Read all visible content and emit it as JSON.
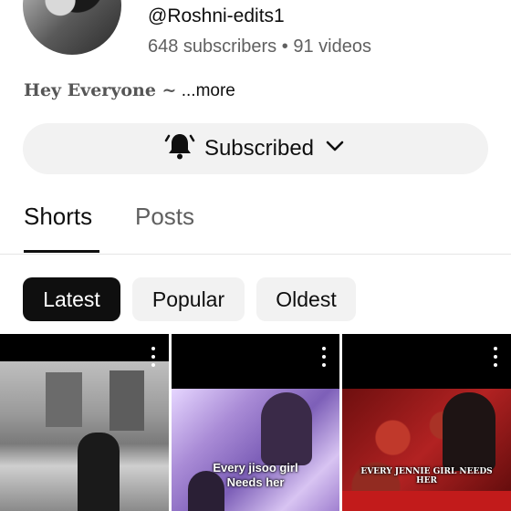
{
  "channel": {
    "handle": "@Roshni-edits1",
    "subscribers": "648 subscribers",
    "separator": "•",
    "videos": "91 videos",
    "description": "Hey Everyone ~",
    "more_label": "...more"
  },
  "subscribe_button": {
    "label": "Subscribed",
    "bell_icon": "bell-icon",
    "dropdown_icon": "chevron-down-icon"
  },
  "tabs": [
    {
      "label": "Shorts",
      "active": true
    },
    {
      "label": "Posts",
      "active": false
    }
  ],
  "filters": [
    {
      "label": "Latest",
      "selected": true
    },
    {
      "label": "Popular",
      "selected": false
    },
    {
      "label": "Oldest",
      "selected": false
    }
  ],
  "shorts": [
    {
      "caption": ""
    },
    {
      "caption_line1": "Every jisoo girl",
      "caption_line2": "Needs her"
    },
    {
      "caption_line1": "EVERY JENNIE GIRL NEEDS",
      "caption_line2": "HER"
    }
  ]
}
